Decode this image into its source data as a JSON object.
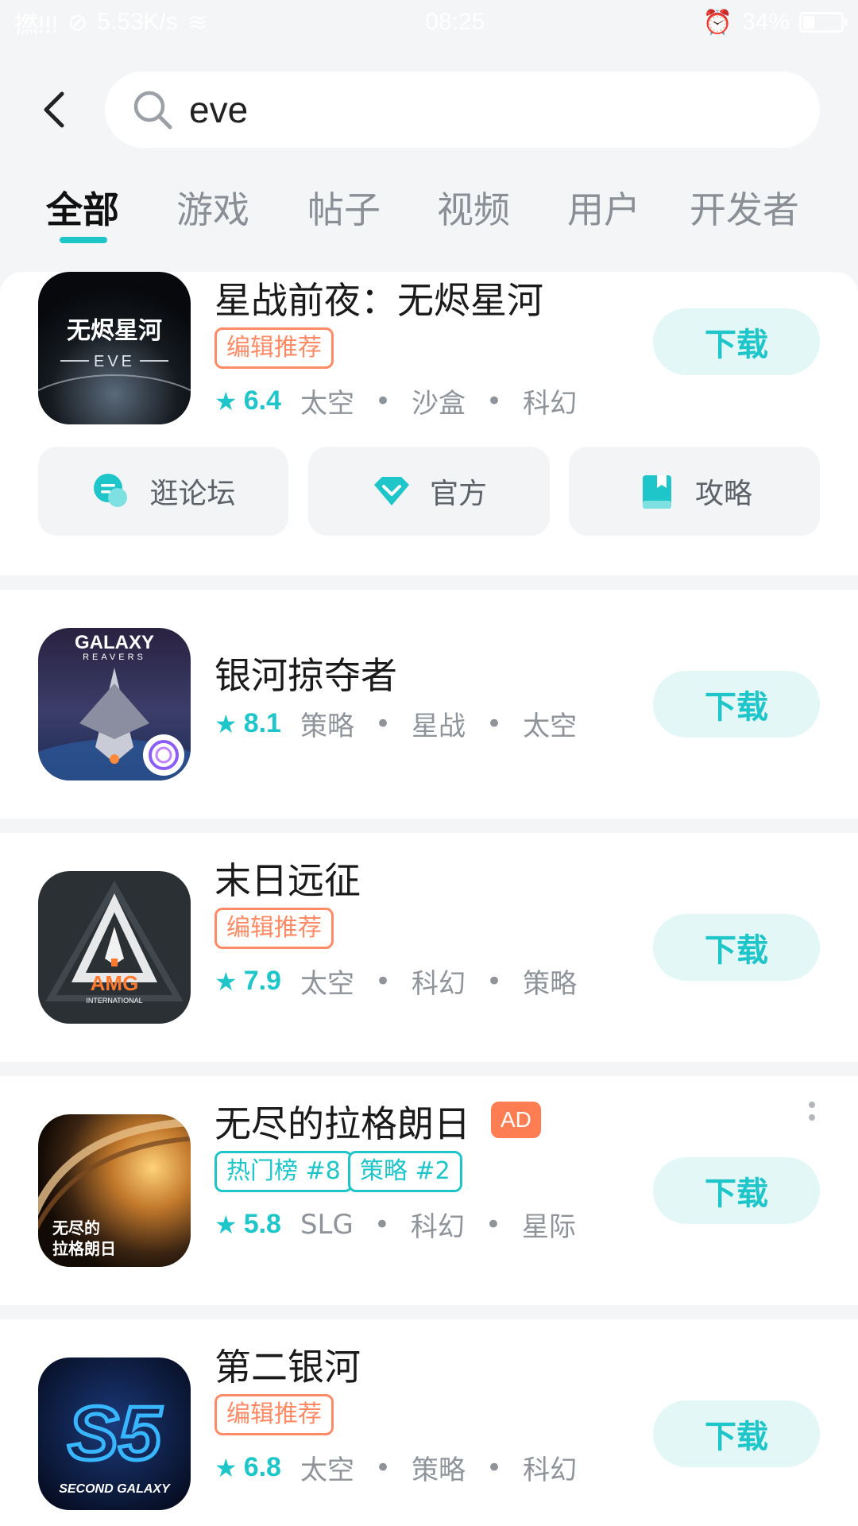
{
  "status_bar": {
    "signal": "撚!!!",
    "speed": "5.53K/s",
    "time": "08:25",
    "battery": "34%"
  },
  "search": {
    "query": "eve",
    "placeholder": ""
  },
  "tabs": [
    {
      "label": "全部",
      "active": true
    },
    {
      "label": "游戏",
      "active": false
    },
    {
      "label": "帖子",
      "active": false
    },
    {
      "label": "视频",
      "active": false
    },
    {
      "label": "用户",
      "active": false
    },
    {
      "label": "开发者",
      "active": false
    }
  ],
  "results": [
    {
      "title": "星战前夜：无烬星河",
      "icon_text": "无烬星河",
      "icon_sub": "EVE",
      "tags": [
        "编辑推荐"
      ],
      "score": "6.4",
      "genres": [
        "太空",
        "沙盒",
        "科幻"
      ],
      "download": "下载",
      "quick_links": [
        "逛论坛",
        "官方",
        "攻略"
      ]
    },
    {
      "title": "银河掠夺者",
      "icon_text": "GALAXY",
      "icon_sub": "REAVERS",
      "tags": [],
      "score": "8.1",
      "genres": [
        "策略",
        "星战",
        "太空"
      ],
      "download": "下载"
    },
    {
      "title": "末日远征",
      "icon_text": "AMG",
      "icon_sub": "INTERNATIONAL",
      "tags": [
        "编辑推荐"
      ],
      "score": "7.9",
      "genres": [
        "太空",
        "科幻",
        "策略"
      ],
      "download": "下载"
    },
    {
      "title": "无尽的拉格朗日",
      "icon_text": "无尽的",
      "icon_sub": "拉格朗日",
      "ad": "AD",
      "tags": [
        "热门榜 #8",
        "策略 #2"
      ],
      "score": "5.8",
      "genres": [
        "SLG",
        "科幻",
        "星际"
      ],
      "download": "下载"
    },
    {
      "title": "第二银河",
      "icon_text": "S5",
      "icon_sub": "SECOND GALAXY",
      "tags": [
        "编辑推荐"
      ],
      "score": "6.8",
      "genres": [
        "太空",
        "策略",
        "科幻"
      ],
      "download": "下载"
    }
  ],
  "colors": {
    "accent": "#1ec5c9",
    "tag_orange": "#ff8a65",
    "ad_orange": "#ff7d52",
    "background": "#f4f5f7"
  }
}
